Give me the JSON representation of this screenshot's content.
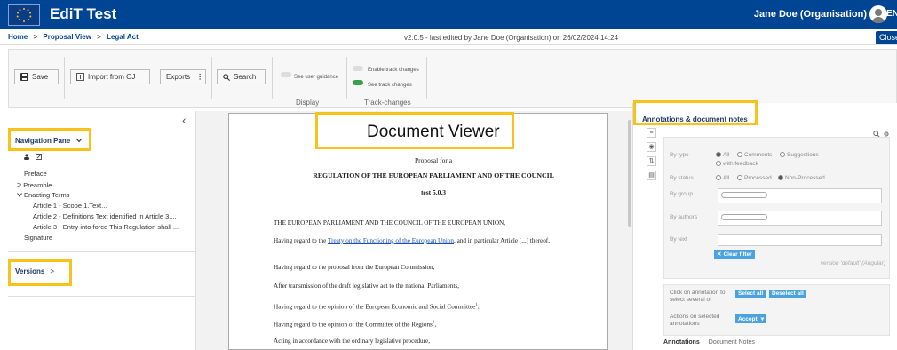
{
  "app": {
    "title": "EdiT Test",
    "user": "Jane Doe (Organisation)",
    "lang": "EN"
  },
  "breadcrumb": {
    "home": "Home",
    "sep1": ">",
    "proposal": "Proposal View",
    "sep2": ">",
    "legal": "Legal Act"
  },
  "version_info": "v2.0.5 - last edited by Jane Doe (Organisation)  on 26/02/2024 14:24",
  "close_label": "Close",
  "toolbar": {
    "save": "Save",
    "import": "Import from OJ",
    "exports": "Exports",
    "exports_icon": "⋮",
    "search": "Search",
    "see_user_guidance": "See user guidance",
    "enable_track": "Enable track changes",
    "see_track": "See track changes",
    "display_label": "Display",
    "track_label": "Track-changes"
  },
  "nav": {
    "title": "Navigation Pane",
    "collapse_icon": "‹",
    "items": [
      "Preface",
      "Preamble",
      "Enacting Terms",
      "Article 1 - Scope 1.Text...",
      "Article 2 - Definitions Text identified in Article 3,...",
      "Article 3 - Entry into force This Regulation shall ...",
      "Signature"
    ],
    "versions": "Versions"
  },
  "viewer": {
    "callout": "Document Viewer",
    "proposal_for": "Proposal for a",
    "regulation": "REGULATION OF THE EUROPEAN PARLIAMENT AND OF THE COUNCIL",
    "test": "test 5.0.3",
    "p1": "THE EUROPEAN PARLIAMENT AND THE COUNCIL OF THE EUROPEAN UNION,",
    "p2a": "Having regard to the ",
    "p2link": "Treaty on the Functioning of the European Union",
    "p2b": ", and in particular Article [...] thereof,",
    "p3": "Having regard to the proposal from the European Commission,",
    "p4": "After transmission of the draft legislative act to the national Parliaments,",
    "p5": "Having regard to the opinion of the European Economic and Social Committee",
    "p5sup": "1",
    "p5end": ",",
    "p6": "Having regard to the opinion of the Committee of the Regions",
    "p6sup": "2",
    "p6end": ",",
    "p7": "Acting in accordance with the ordinary legislative procedure,"
  },
  "annotations": {
    "title": "Annotations & document notes",
    "by_type": "By type",
    "all": "All",
    "comments": "Comments",
    "suggestions": "Suggestions",
    "with_feedback": "with feedback",
    "by_status": "By status",
    "status_all": "All",
    "processed": "Processed",
    "non_processed": "Non-Processed",
    "by_group": "By group",
    "by_authors": "By authors",
    "by_text": "By text",
    "clear_filter": "Clear filter",
    "version_text": "version 'default' (Angular)",
    "click_hint_1": "Click on annotation to",
    "click_hint_2": "select several or",
    "select_all": "Select all",
    "deselect_all": "Deselect all",
    "actions_1": "Actions on selected",
    "actions_2": "annotations",
    "accept": "Accept",
    "tab_annotations": "Annotations",
    "tab_notes": "Document Notes"
  },
  "colors": {
    "brand": "#004494",
    "highlight": "#f7c31a",
    "accent_button": "#4aa3e0",
    "toggle_on": "#3aa14b"
  }
}
